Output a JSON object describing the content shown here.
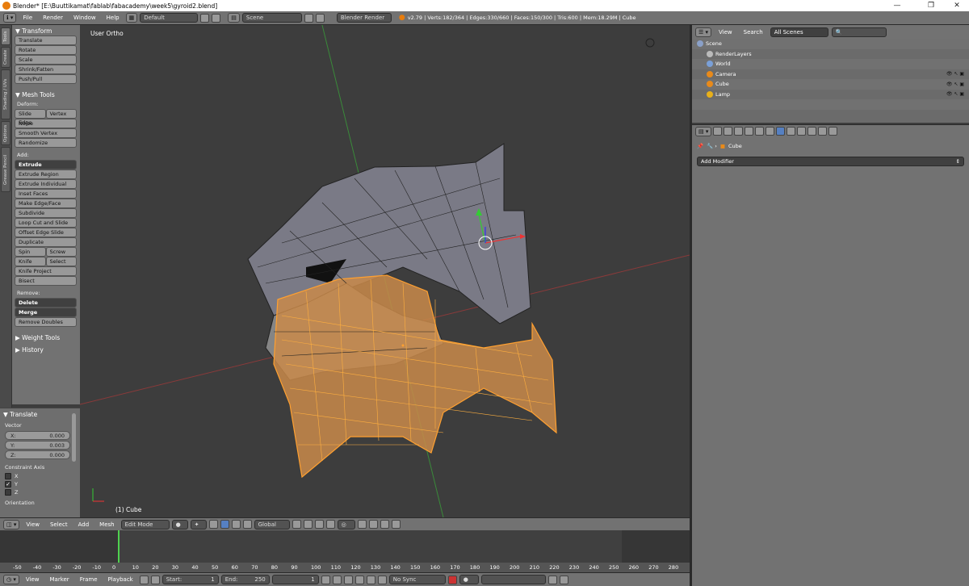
{
  "window": {
    "title": "Blender* [E:\\Buuttikamat\\fablab\\fabacademy\\week5\\gyroid2.blend]"
  },
  "top_menu": {
    "items": [
      "File",
      "Render",
      "Window",
      "Help"
    ],
    "screen_layout": "Default",
    "scene": "Scene",
    "render_engine": "Blender Render",
    "stats": "v2.79 | Verts:182/364 | Edges:330/660 | Faces:150/300 | Tris:600 | Mem:18.29M | Cube"
  },
  "tabs": [
    "Tools",
    "Create",
    "Shading / UVs",
    "Options",
    "Grease Pencil"
  ],
  "tool_shelf": {
    "transform": {
      "header": "▼ Transform",
      "buttons": [
        "Translate",
        "Rotate",
        "Scale",
        "Shrink/Fatten",
        "Push/Pull"
      ]
    },
    "mesh_tools": {
      "header": "▼ Mesh Tools",
      "deform_label": "Deform:",
      "deform": [
        [
          "Slide Edge",
          "Vertex"
        ],
        [
          "Noise"
        ],
        [
          "Smooth Vertex"
        ],
        [
          "Randomize"
        ]
      ],
      "add_label": "Add:",
      "extrude": "Extrude",
      "add": [
        "Extrude Region",
        "Extrude Individual",
        "Inset Faces",
        "Make Edge/Face",
        "Subdivide",
        "Loop Cut and Slide",
        "Offset Edge Slide",
        "Duplicate"
      ],
      "pairs": [
        [
          "Spin",
          "Screw"
        ],
        [
          "Knife",
          "Select"
        ]
      ],
      "add2": [
        "Knife Project",
        "Bisect"
      ],
      "remove_label": "Remove:",
      "delete": "Delete",
      "merge": "Merge",
      "remove_doubles": "Remove Doubles"
    },
    "weight_tools": "▶ Weight Tools",
    "history": "▶ History"
  },
  "operator": {
    "header": "▼ Translate",
    "vector_label": "Vector",
    "x_label": "X:",
    "x": "0.000",
    "y_label": "Y:",
    "y": "0.003",
    "z_label": "Z:",
    "z": "0.000",
    "constraint_label": "Constraint Axis",
    "axes": [
      {
        "label": "X",
        "checked": false
      },
      {
        "label": "Y",
        "checked": true
      },
      {
        "label": "Z",
        "checked": false
      }
    ],
    "orientation_label": "Orientation"
  },
  "viewport": {
    "view_name": "User Ortho",
    "object_label": "(1) Cube"
  },
  "view3d_header": {
    "menus": [
      "View",
      "Select",
      "Add",
      "Mesh"
    ],
    "mode": "Edit Mode",
    "orientation": "Global"
  },
  "timeline": {
    "ticks": [
      "-50",
      "-40",
      "-30",
      "-20",
      "-10",
      "0",
      "10",
      "20",
      "30",
      "40",
      "50",
      "60",
      "70",
      "80",
      "90",
      "100",
      "110",
      "120",
      "130",
      "140",
      "150",
      "160",
      "170",
      "180",
      "190",
      "200",
      "210",
      "220",
      "230",
      "240",
      "250",
      "260",
      "270",
      "280"
    ],
    "menus": [
      "View",
      "Marker",
      "Frame",
      "Playback"
    ],
    "start_label": "Start:",
    "start": "1",
    "end_label": "End:",
    "end": "250",
    "current": "1",
    "sync": "No Sync"
  },
  "outliner": {
    "menus": [
      "View",
      "Search"
    ],
    "filter": "All Scenes",
    "rows": [
      {
        "label": "Scene",
        "indent": 0,
        "color": "#8aa0c8"
      },
      {
        "label": "RenderLayers",
        "indent": 1,
        "color": "#bbbbbb"
      },
      {
        "label": "World",
        "indent": 1,
        "color": "#7aa0d8"
      },
      {
        "label": "Camera",
        "indent": 1,
        "color": "#e88a1a"
      },
      {
        "label": "Cube",
        "indent": 1,
        "color": "#e88a1a"
      },
      {
        "label": "Lamp",
        "indent": 1,
        "color": "#e8b01a"
      }
    ]
  },
  "properties": {
    "breadcrumb": "Cube",
    "add_modifier": "Add Modifier"
  }
}
